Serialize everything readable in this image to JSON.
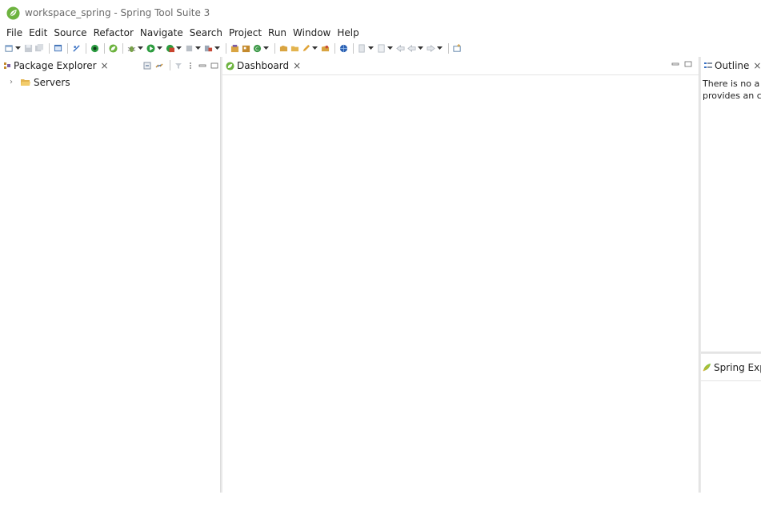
{
  "window": {
    "title": "workspace_spring - Spring Tool Suite 3",
    "icon": "spring-leaf-icon",
    "accent_color": "#6db33f"
  },
  "menubar": {
    "items": [
      "File",
      "Edit",
      "Source",
      "Refactor",
      "Navigate",
      "Search",
      "Project",
      "Run",
      "Window",
      "Help"
    ]
  },
  "package_explorer": {
    "tab_label": "Package Explorer",
    "close_glyph": "×",
    "tree": [
      {
        "label": "Servers",
        "expand_glyph": "›"
      }
    ]
  },
  "editor": {
    "tab_label": "Dashboard",
    "close_glyph": "×"
  },
  "outline": {
    "tab_label": "Outline",
    "close_glyph": "×",
    "message_line1": "There is no a",
    "message_line2": "provides an c"
  },
  "spring_explorer": {
    "tab_label": "Spring Expl"
  }
}
